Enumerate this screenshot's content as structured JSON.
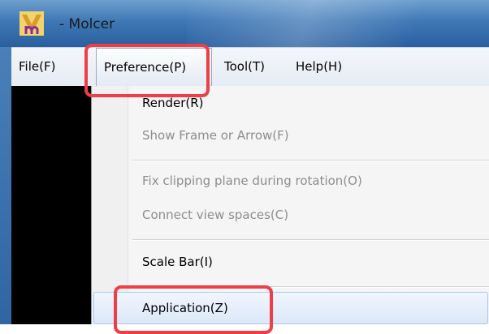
{
  "window": {
    "title": "- Molcer",
    "icon": "molcer-app-icon"
  },
  "menubar": {
    "items": [
      {
        "label": "File(F)"
      },
      {
        "label": "Preference(P)"
      },
      {
        "label": "Tool(T)"
      },
      {
        "label": "Help(H)"
      }
    ],
    "active": "Preference(P)"
  },
  "dropdown": {
    "items": [
      {
        "label": "Render(R)",
        "enabled": true
      },
      {
        "label": "Show Frame or Arrow(F)",
        "enabled": false
      },
      {
        "label": "Fix clipping plane during rotation(O)",
        "enabled": false
      },
      {
        "label": "Connect view spaces(C)",
        "enabled": false
      },
      {
        "label": "Scale Bar(I)",
        "enabled": true
      },
      {
        "label": "Application(Z)",
        "enabled": true,
        "hovered": true
      }
    ]
  },
  "colors": {
    "highlight": "#ee3f46",
    "canvas": "#000000",
    "titlebar": "#3f78b6"
  }
}
